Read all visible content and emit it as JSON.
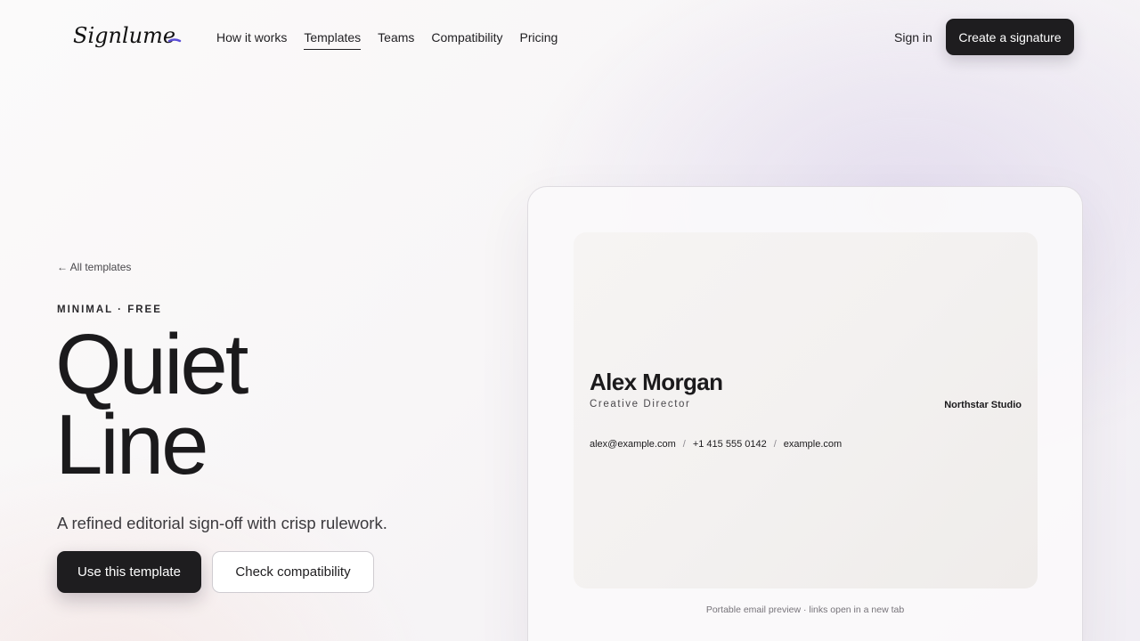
{
  "brand": {
    "logo_text": "Signlume"
  },
  "nav": {
    "items": [
      {
        "label": "How it works"
      },
      {
        "label": "Templates",
        "active": true
      },
      {
        "label": "Teams"
      },
      {
        "label": "Compatibility"
      },
      {
        "label": "Pricing"
      }
    ],
    "sign_in": "Sign in",
    "cta": "Create a signature"
  },
  "hero": {
    "back_link": "← All templates",
    "eyebrow": "MINIMAL · FREE",
    "title_line1": "Quiet",
    "title_line2": "Line",
    "subtitle": "A refined editorial sign-off with crisp rulework.",
    "primary_button": "Use this template",
    "secondary_button": "Check compatibility"
  },
  "preview": {
    "name": "Alex Morgan",
    "role": "Creative Director",
    "company": "Northstar Studio",
    "email": "alex@example.com",
    "separator": "/",
    "phone": "+1 415 555 0142",
    "website": "example.com",
    "note": "Portable email preview · links open in a new tab"
  },
  "colors": {
    "ink": "#1e1d1f",
    "logo_accent": "#5b4fd6"
  }
}
